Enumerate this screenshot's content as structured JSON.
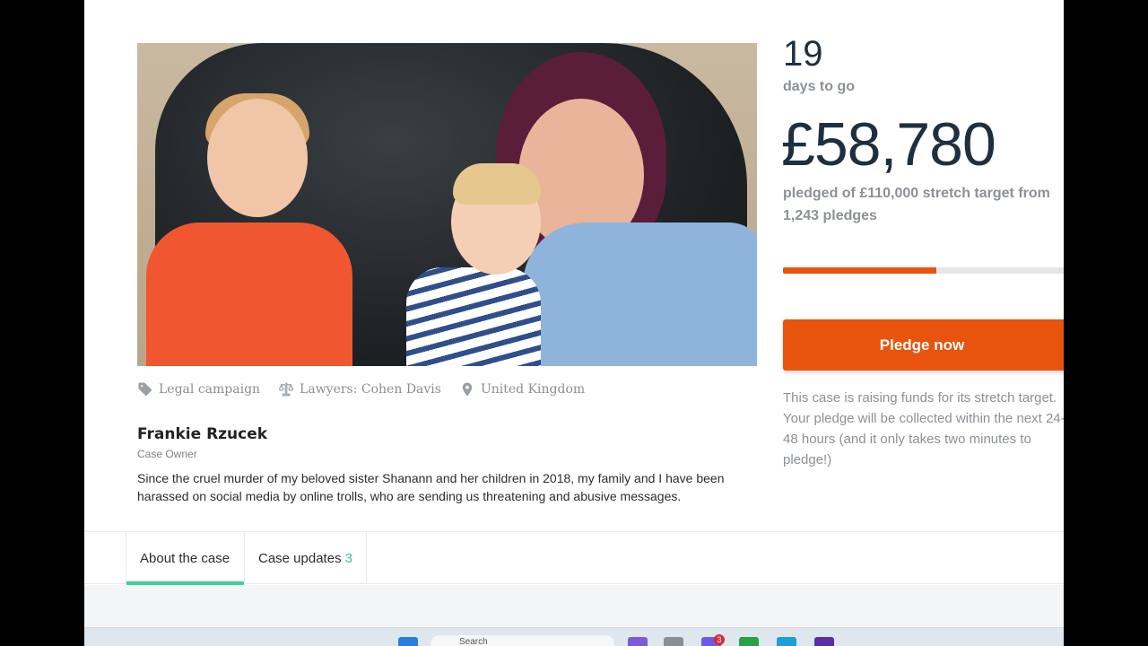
{
  "campaign": {
    "tags": [
      {
        "icon": "tag-icon",
        "label": "Legal campaign"
      },
      {
        "icon": "scales-icon",
        "label": "Lawyers: Cohen Davis"
      },
      {
        "icon": "location-pin-icon",
        "label": "United Kingdom"
      }
    ],
    "owner_name": "Frankie Rzucek",
    "owner_role": "Case Owner",
    "description": "Since the cruel murder of my beloved sister Shanann and her children in 2018, my family and I have been harassed on social media by online trolls, who are sending us threatening and abusive messages."
  },
  "stats": {
    "days_left": "19",
    "days_label": "days to go",
    "amount": "£58,780",
    "pledged_text": "pledged of £110,000 stretch target from 1,243 pledges",
    "progress_fraction": 0.534,
    "pledge_button": "Pledge now",
    "note": "This case is raising funds for its stretch target. Your pledge will be collected within the next 24-48 hours (and it only takes two minutes to pledge!)"
  },
  "tabs": [
    {
      "label": "About the case",
      "count": "",
      "active": true
    },
    {
      "label": "Case updates",
      "count": "3",
      "active": false
    }
  ],
  "taskbar": {
    "search_placeholder": "Search",
    "notification_count": "3"
  },
  "colors": {
    "accent_orange": "#e8540e",
    "tab_underline": "#3fcf9a",
    "amount_text": "#1e3040"
  }
}
